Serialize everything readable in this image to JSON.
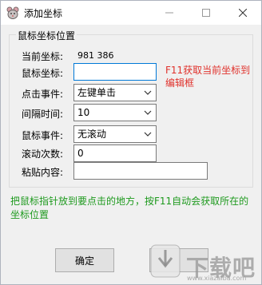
{
  "window": {
    "title": "添加坐标"
  },
  "group": {
    "title": "鼠标坐标位置"
  },
  "current_coords": {
    "label": "当前坐标:",
    "value": "981 386"
  },
  "fields": {
    "mouse_coords": {
      "label": "鼠标坐标:",
      "value": ""
    },
    "click_event": {
      "label": "点击事件:",
      "value": "左键单击"
    },
    "interval": {
      "label": "间隔时间:",
      "value": "10"
    },
    "mouse_event": {
      "label": "鼠标事件:",
      "value": "无滚动"
    },
    "scroll_count": {
      "label": "滚动次数:",
      "value": "0"
    },
    "paste_content": {
      "label": "粘贴内容:",
      "value": ""
    }
  },
  "hints": {
    "f11_hint": "F11获取当前坐标到编辑框",
    "instruction": "把鼠标指针放到要点击的地方，按F11自动会获取所在的坐标位置"
  },
  "buttons": {
    "ok": "确定"
  },
  "watermark": {
    "text": "下载吧",
    "url": "www.xiazaiba.com"
  },
  "colors": {
    "hint_red": "#e0312b",
    "hint_green": "#1e9a1e",
    "focus_border": "#0078d7"
  }
}
